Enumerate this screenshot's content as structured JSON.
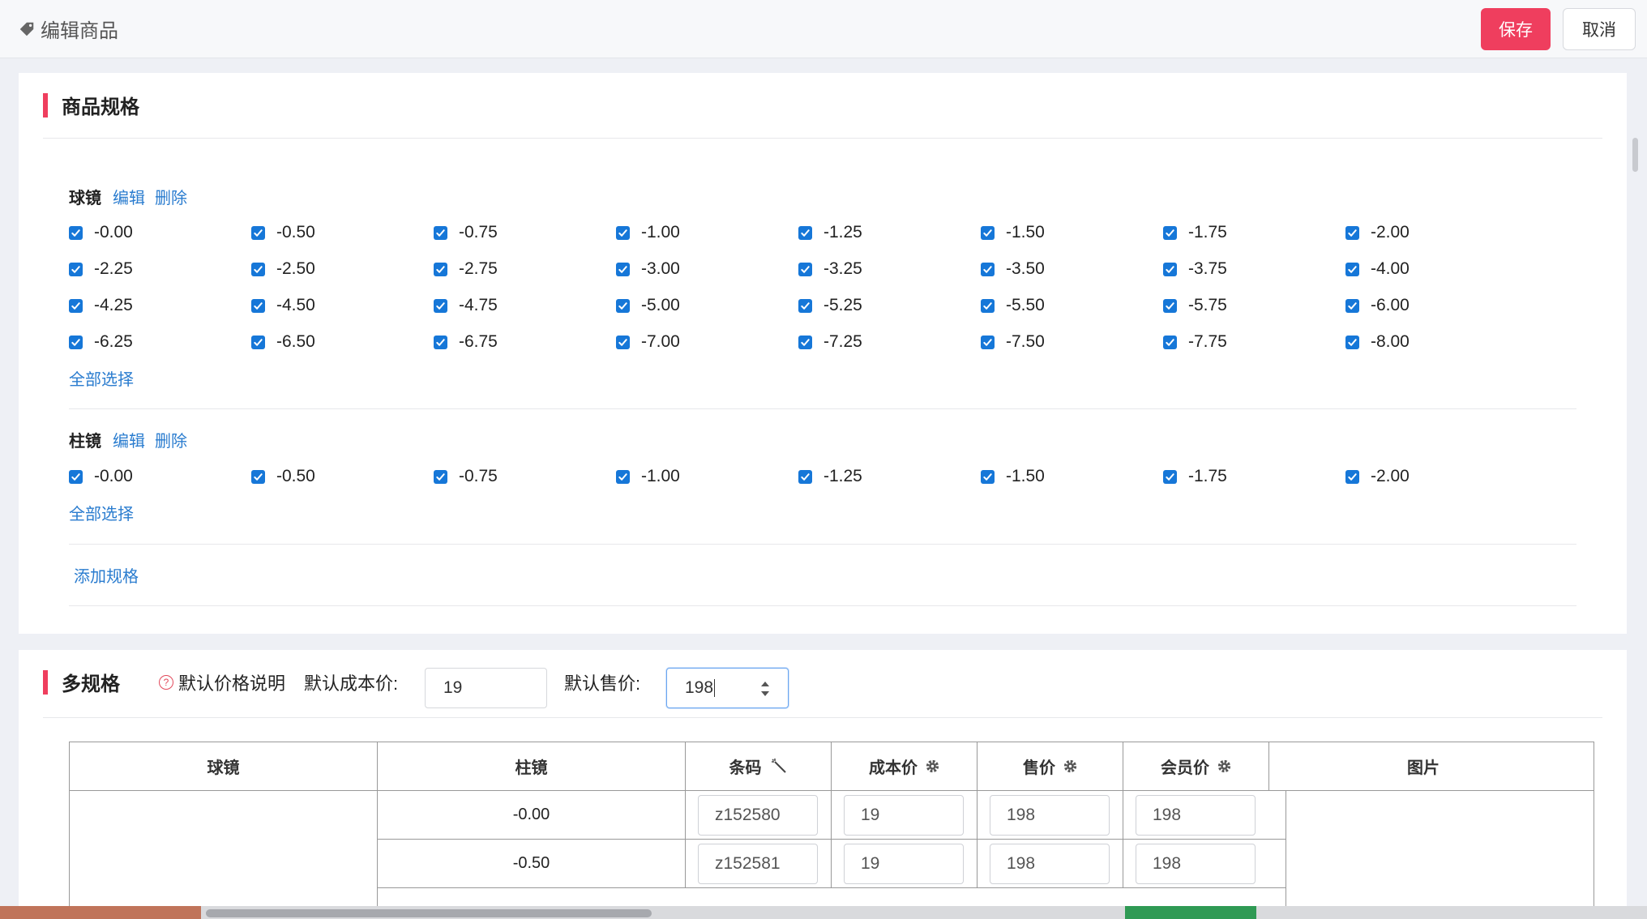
{
  "header": {
    "title": "编辑商品",
    "save_label": "保存",
    "cancel_label": "取消"
  },
  "spec_section": {
    "title": "商品规格",
    "groups": [
      {
        "name": "球镜",
        "edit_label": "编辑",
        "delete_label": "删除",
        "options": [
          "-0.00",
          "-0.50",
          "-0.75",
          "-1.00",
          "-1.25",
          "-1.50",
          "-1.75",
          "-2.00",
          "-2.25",
          "-2.50",
          "-2.75",
          "-3.00",
          "-3.25",
          "-3.50",
          "-3.75",
          "-4.00",
          "-4.25",
          "-4.50",
          "-4.75",
          "-5.00",
          "-5.25",
          "-5.50",
          "-5.75",
          "-6.00",
          "-6.25",
          "-6.50",
          "-6.75",
          "-7.00",
          "-7.25",
          "-7.50",
          "-7.75",
          "-8.00"
        ],
        "select_all_label": "全部选择"
      },
      {
        "name": "柱镜",
        "edit_label": "编辑",
        "delete_label": "删除",
        "options": [
          "-0.00",
          "-0.50",
          "-0.75",
          "-1.00",
          "-1.25",
          "-1.50",
          "-1.75",
          "-2.00"
        ],
        "select_all_label": "全部选择"
      }
    ],
    "add_spec_label": "添加规格"
  },
  "multi_section": {
    "title": "多规格",
    "help_label": "默认价格说明",
    "default_cost_label": "默认成本价:",
    "default_cost_value": "19",
    "default_price_label": "默认售价:",
    "default_price_value": "198",
    "table": {
      "headers": [
        "球镜",
        "柱镜",
        "条码",
        "成本价",
        "售价",
        "会员价",
        "图片"
      ],
      "rows": [
        {
          "cyl": "-0.00",
          "barcode": "z152580",
          "cost": "19",
          "price": "198",
          "member_price": "198"
        },
        {
          "cyl": "-0.50",
          "barcode": "z152581",
          "cost": "19",
          "price": "198",
          "member_price": "198"
        }
      ]
    }
  },
  "colors": {
    "accent": "#ef3e5e",
    "link": "#2a7ccf",
    "checkbox": "#1677d8"
  }
}
